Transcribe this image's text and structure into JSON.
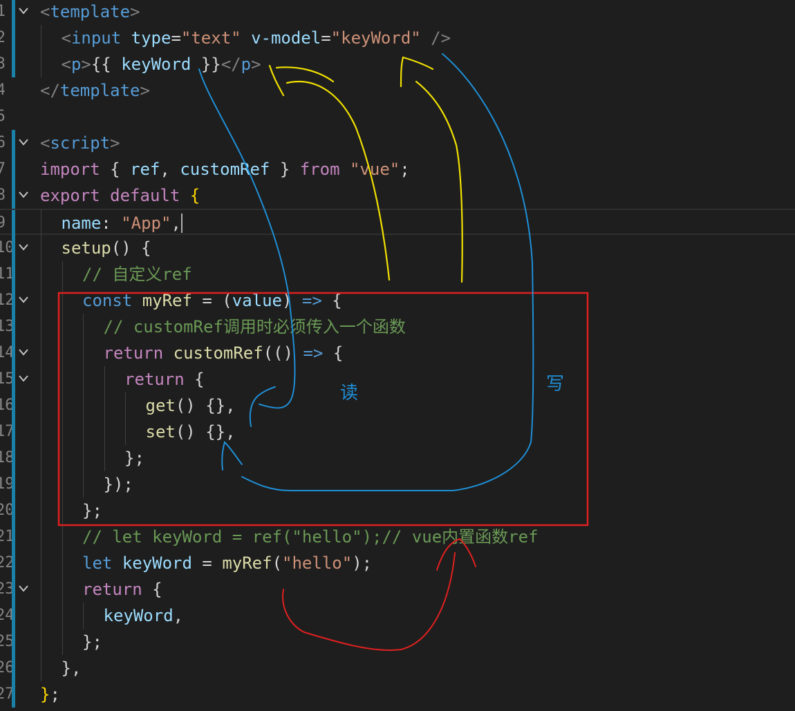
{
  "editor": {
    "theme_colors": {
      "background": "#1e1e1e",
      "gutter_number": "#858585",
      "git_modified_bar": "#1b81a8",
      "annotation_red": "#e02020",
      "annotation_yellow": "#f0e000",
      "annotation_blue": "#1f8fd6"
    },
    "lines": [
      {
        "num": "1",
        "fold": true,
        "git": true,
        "indent": 0,
        "tokens": [
          {
            "t": "<",
            "c": "punc"
          },
          {
            "t": "template",
            "c": "tag"
          },
          {
            "t": ">",
            "c": "punc"
          }
        ]
      },
      {
        "num": "2",
        "fold": false,
        "git": true,
        "indent": 1,
        "tokens": [
          {
            "t": "<",
            "c": "punc"
          },
          {
            "t": "input",
            "c": "tag"
          },
          {
            "t": " ",
            "c": "plain"
          },
          {
            "t": "type",
            "c": "attr"
          },
          {
            "t": "=",
            "c": "plain"
          },
          {
            "t": "\"text\"",
            "c": "str"
          },
          {
            "t": " ",
            "c": "plain"
          },
          {
            "t": "v-model",
            "c": "attr"
          },
          {
            "t": "=",
            "c": "plain"
          },
          {
            "t": "\"keyWord\"",
            "c": "str"
          },
          {
            "t": " />",
            "c": "punc"
          }
        ]
      },
      {
        "num": "3",
        "fold": false,
        "git": true,
        "indent": 1,
        "tokens": [
          {
            "t": "<",
            "c": "punc"
          },
          {
            "t": "p",
            "c": "tag"
          },
          {
            "t": ">",
            "c": "punc"
          },
          {
            "t": "{{ ",
            "c": "plain"
          },
          {
            "t": "keyWord",
            "c": "var"
          },
          {
            "t": " }}",
            "c": "plain"
          },
          {
            "t": "</",
            "c": "punc"
          },
          {
            "t": "p",
            "c": "tag"
          },
          {
            "t": ">",
            "c": "punc"
          }
        ]
      },
      {
        "num": "4",
        "fold": false,
        "git": false,
        "indent": 0,
        "tokens": [
          {
            "t": "</",
            "c": "punc"
          },
          {
            "t": "template",
            "c": "tag"
          },
          {
            "t": ">",
            "c": "punc"
          }
        ]
      },
      {
        "num": "5",
        "fold": false,
        "git": false,
        "indent": 0,
        "tokens": []
      },
      {
        "num": "6",
        "fold": true,
        "git": true,
        "indent": 0,
        "tokens": [
          {
            "t": "<",
            "c": "punc"
          },
          {
            "t": "script",
            "c": "tag"
          },
          {
            "t": ">",
            "c": "punc"
          }
        ]
      },
      {
        "num": "7",
        "fold": false,
        "git": true,
        "indent": 0,
        "tokens": [
          {
            "t": "import",
            "c": "kw"
          },
          {
            "t": " { ",
            "c": "plain"
          },
          {
            "t": "ref",
            "c": "var"
          },
          {
            "t": ", ",
            "c": "plain"
          },
          {
            "t": "customRef",
            "c": "var"
          },
          {
            "t": " } ",
            "c": "plain"
          },
          {
            "t": "from",
            "c": "kw"
          },
          {
            "t": " ",
            "c": "plain"
          },
          {
            "t": "\"vue\"",
            "c": "str"
          },
          {
            "t": ";",
            "c": "plain"
          }
        ]
      },
      {
        "num": "8",
        "fold": true,
        "git": true,
        "indent": 0,
        "tokens": [
          {
            "t": "export",
            "c": "kw"
          },
          {
            "t": " ",
            "c": "plain"
          },
          {
            "t": "default",
            "c": "kw"
          },
          {
            "t": " ",
            "c": "plain"
          },
          {
            "t": "{",
            "c": "bracket"
          }
        ]
      },
      {
        "num": "9",
        "fold": false,
        "git": true,
        "indent": 1,
        "active": true,
        "tokens": [
          {
            "t": "name",
            "c": "var"
          },
          {
            "t": ": ",
            "c": "plain"
          },
          {
            "t": "\"App\"",
            "c": "str"
          },
          {
            "t": ",",
            "c": "plain"
          }
        ]
      },
      {
        "num": "10",
        "fold": true,
        "git": true,
        "indent": 1,
        "tokens": [
          {
            "t": "setup",
            "c": "fn"
          },
          {
            "t": "() ",
            "c": "plain"
          },
          {
            "t": "{",
            "c": "plain"
          }
        ]
      },
      {
        "num": "11",
        "fold": false,
        "git": true,
        "indent": 2,
        "tokens": [
          {
            "t": "// 自定义ref",
            "c": "com"
          }
        ]
      },
      {
        "num": "12",
        "fold": true,
        "git": true,
        "indent": 2,
        "tokens": [
          {
            "t": "const",
            "c": "key"
          },
          {
            "t": " ",
            "c": "plain"
          },
          {
            "t": "myRef",
            "c": "fn"
          },
          {
            "t": " = (",
            "c": "plain"
          },
          {
            "t": "value",
            "c": "var"
          },
          {
            "t": ") ",
            "c": "plain"
          },
          {
            "t": "=>",
            "c": "key"
          },
          {
            "t": " {",
            "c": "plain"
          }
        ]
      },
      {
        "num": "13",
        "fold": false,
        "git": true,
        "indent": 3,
        "tokens": [
          {
            "t": "// customRef调用时必须传入一个函数",
            "c": "com"
          }
        ]
      },
      {
        "num": "14",
        "fold": true,
        "git": true,
        "indent": 3,
        "tokens": [
          {
            "t": "return",
            "c": "kw"
          },
          {
            "t": " ",
            "c": "plain"
          },
          {
            "t": "customRef",
            "c": "fn"
          },
          {
            "t": "((",
            "c": "plain"
          },
          {
            "t": ") ",
            "c": "plain"
          },
          {
            "t": "=>",
            "c": "key"
          },
          {
            "t": " {",
            "c": "plain"
          }
        ]
      },
      {
        "num": "15",
        "fold": true,
        "git": true,
        "indent": 4,
        "tokens": [
          {
            "t": "return",
            "c": "kw"
          },
          {
            "t": " {",
            "c": "plain"
          }
        ]
      },
      {
        "num": "16",
        "fold": false,
        "git": true,
        "indent": 5,
        "tokens": [
          {
            "t": "get",
            "c": "fn"
          },
          {
            "t": "() {},",
            "c": "plain"
          }
        ]
      },
      {
        "num": "17",
        "fold": false,
        "git": true,
        "indent": 5,
        "tokens": [
          {
            "t": "set",
            "c": "fn"
          },
          {
            "t": "() {},",
            "c": "plain"
          }
        ]
      },
      {
        "num": "18",
        "fold": false,
        "git": true,
        "indent": 4,
        "tokens": [
          {
            "t": "};",
            "c": "plain"
          }
        ]
      },
      {
        "num": "19",
        "fold": false,
        "git": true,
        "indent": 3,
        "tokens": [
          {
            "t": "});",
            "c": "plain"
          }
        ]
      },
      {
        "num": "20",
        "fold": false,
        "git": true,
        "indent": 2,
        "tokens": [
          {
            "t": "};",
            "c": "plain"
          }
        ]
      },
      {
        "num": "21",
        "fold": false,
        "git": true,
        "indent": 2,
        "tokens": [
          {
            "t": "// let keyWord = ref(\"hello\");// vue内置函数ref",
            "c": "com"
          }
        ]
      },
      {
        "num": "22",
        "fold": false,
        "git": true,
        "indent": 2,
        "tokens": [
          {
            "t": "let",
            "c": "key"
          },
          {
            "t": " ",
            "c": "plain"
          },
          {
            "t": "keyWord",
            "c": "var"
          },
          {
            "t": " = ",
            "c": "plain"
          },
          {
            "t": "myRef",
            "c": "fn"
          },
          {
            "t": "(",
            "c": "plain"
          },
          {
            "t": "\"hello\"",
            "c": "str"
          },
          {
            "t": ");",
            "c": "plain"
          }
        ]
      },
      {
        "num": "23",
        "fold": true,
        "git": true,
        "indent": 2,
        "tokens": [
          {
            "t": "return",
            "c": "kw"
          },
          {
            "t": " {",
            "c": "plain"
          }
        ]
      },
      {
        "num": "24",
        "fold": false,
        "git": true,
        "indent": 3,
        "tokens": [
          {
            "t": "keyWord",
            "c": "var"
          },
          {
            "t": ",",
            "c": "plain"
          }
        ]
      },
      {
        "num": "25",
        "fold": false,
        "git": true,
        "indent": 2,
        "tokens": [
          {
            "t": "};",
            "c": "plain"
          }
        ]
      },
      {
        "num": "26",
        "fold": false,
        "git": true,
        "indent": 1,
        "tokens": [
          {
            "t": "},",
            "c": "plain"
          }
        ]
      },
      {
        "num": "27",
        "fold": false,
        "git": true,
        "indent": 0,
        "tokens": [
          {
            "t": "}",
            "c": "bracket"
          },
          {
            "t": ";",
            "c": "plain"
          }
        ]
      }
    ]
  },
  "annotations": {
    "read_label": "读",
    "write_label": "写"
  }
}
